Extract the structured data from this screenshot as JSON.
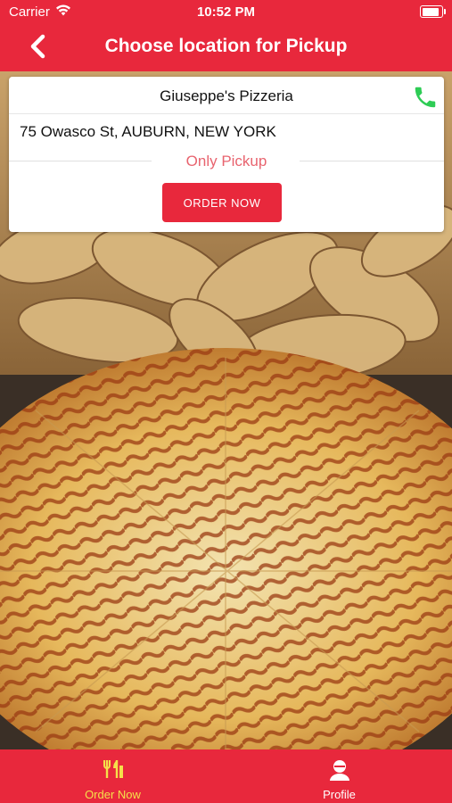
{
  "status_bar": {
    "carrier": "Carrier",
    "time": "10:52 PM",
    "battery_level": 0.9
  },
  "header": {
    "title": "Choose location for Pickup",
    "back_icon": "chevron-left-icon"
  },
  "location_card": {
    "name": "Giuseppe's Pizzeria",
    "address": "75 Owasco St, AUBURN, NEW YORK",
    "pickup_text": "Only Pickup",
    "order_button_label": "ORDER NOW",
    "phone_icon": "phone-icon"
  },
  "background": {
    "image": "photo of garlic knots and a barbecue chicken pizza"
  },
  "tab_bar": {
    "items": [
      {
        "label": "Order Now",
        "icon": "fork-knife-icon",
        "active": true
      },
      {
        "label": "Profile",
        "icon": "user-icon",
        "active": false
      }
    ]
  },
  "colors": {
    "brand": "#e8283c",
    "active_tab": "#f5e04a",
    "pickup_text": "#e8646f",
    "phone_icon": "#2ecc55"
  }
}
